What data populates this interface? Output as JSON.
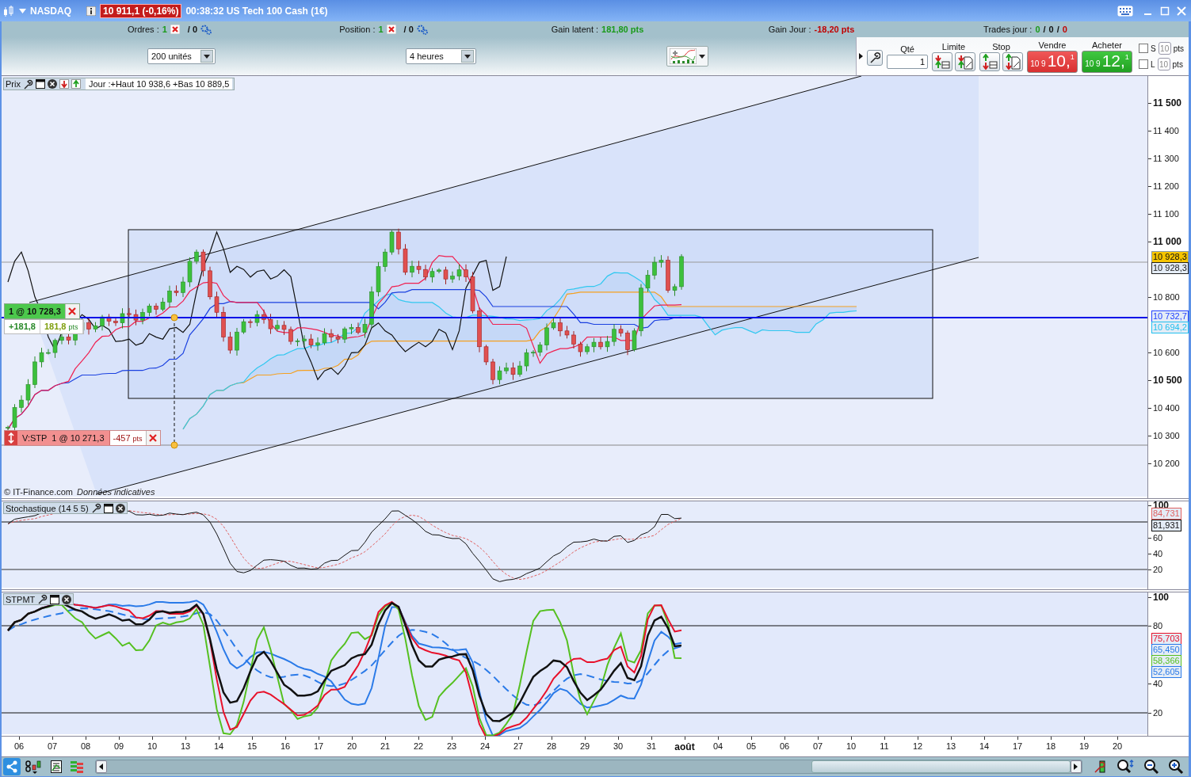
{
  "title_bar": {
    "instrument": "NASDAQ",
    "quote": "10 911,1 (-0,16%)",
    "description": "00:38:32 US Tech 100 Cash (1€)"
  },
  "info_bar": [
    {
      "kind": "count",
      "label": "Ordres :",
      "value": "1",
      "total": "/ 0"
    },
    {
      "kind": "count",
      "label": "Position :",
      "value": "1",
      "total": "/ 0"
    },
    {
      "kind": "gain",
      "label": "Gain latent :",
      "value": "181,80 pts",
      "color": "#1a9a1a"
    },
    {
      "kind": "gain",
      "label": "Gain Jour :",
      "value": "-18,20 pts",
      "color": "#c00000"
    },
    {
      "kind": "trades",
      "label": "Trades jour :",
      "values": [
        {
          "text": "0",
          "color": "#1a9a1a"
        },
        {
          "text": "0",
          "color": "#111111"
        },
        {
          "text": "0",
          "color": "#c00000"
        }
      ],
      "separators": [
        "/",
        "/"
      ]
    }
  ],
  "toolbar": {
    "units": "200 unités",
    "period": "4 heures"
  },
  "order_panel": {
    "qty_label": "Qté",
    "qty": "1",
    "limit_label": "Limite",
    "stop_label": "Stop",
    "sell": {
      "label": "Vendre",
      "prefix": "10 9",
      "big": "10,",
      "sup": "1"
    },
    "buy": {
      "label": "Acheter",
      "prefix": "10 9",
      "big": "12,",
      "sup": "1"
    },
    "stops": [
      {
        "label": "S",
        "value": "10",
        "unit": "pts",
        "checked": false
      },
      {
        "label": "L",
        "value": "10",
        "unit": "pts",
        "checked": false
      }
    ]
  },
  "price_pane": {
    "legend": "Prix",
    "day_info": "Jour :+Haut 10 938,6 +Bas 10 889,5",
    "y_ticks": [
      {
        "label": "11 500",
        "bold": true
      },
      {
        "label": "11 400",
        "bold": false
      },
      {
        "label": "11 300",
        "bold": false
      },
      {
        "label": "11 200",
        "bold": false
      },
      {
        "label": "11 100",
        "bold": false
      },
      {
        "label": "11 000",
        "bold": true
      },
      {
        "label": "10 800",
        "bold": false
      },
      {
        "label": "10 600",
        "bold": false
      },
      {
        "label": "10 500",
        "bold": true
      },
      {
        "label": "10 400",
        "bold": false
      },
      {
        "label": "10 300",
        "bold": false
      },
      {
        "label": "10 200",
        "bold": false
      }
    ],
    "tags": [
      {
        "text": "10 928,3",
        "kind": "filled",
        "color": "#f5c400"
      },
      {
        "text": "10 928,3",
        "kind": "outlined",
        "color": "#222222"
      },
      {
        "text": "10 732,7",
        "kind": "outlined",
        "color": "#2040ff"
      },
      {
        "text": "10 694,2",
        "kind": "outlined",
        "color": "#22c0ee"
      }
    ],
    "position_tag": {
      "label": "1 @ 10 728,3",
      "pnl": "+181,8",
      "points": "181,8",
      "unit": "pts"
    },
    "stop_tag": {
      "label": "V:STP  1 @ 10 271,3",
      "points": "-457",
      "unit": "pts"
    },
    "copyright": "© IT-Finance.com",
    "disclaimer": "Données indicatives"
  },
  "stochastic_pane": {
    "legend": "Stochastique (14 5 5)",
    "y_ticks": [
      {
        "label": "100",
        "bold": true
      },
      {
        "label": "60",
        "bold": false
      },
      {
        "label": "40",
        "bold": false
      },
      {
        "label": "20",
        "bold": false
      }
    ],
    "tags": [
      {
        "text": "84,731",
        "color": "#e06060"
      },
      {
        "text": "81,931",
        "color": "#111111"
      }
    ]
  },
  "stpmt_pane": {
    "legend": "STPMT",
    "y_ticks": [
      {
        "label": "100",
        "bold": true
      },
      {
        "label": "80",
        "bold": false
      },
      {
        "label": "40",
        "bold": false
      },
      {
        "label": "20",
        "bold": false
      }
    ],
    "tags": [
      {
        "text": "75,703",
        "color": "#e8102a"
      },
      {
        "text": "65,450",
        "color": "#2a7ae8"
      },
      {
        "text": "58,366",
        "color": "#55c020"
      },
      {
        "text": "52,605",
        "color": "#2a7ae8"
      }
    ]
  },
  "x_axis": [
    {
      "label": "06",
      "bold": false
    },
    {
      "label": "07",
      "bold": false
    },
    {
      "label": "08",
      "bold": false
    },
    {
      "label": "09",
      "bold": false
    },
    {
      "label": "10",
      "bold": false
    },
    {
      "label": "13",
      "bold": false
    },
    {
      "label": "14",
      "bold": false
    },
    {
      "label": "15",
      "bold": false
    },
    {
      "label": "16",
      "bold": false
    },
    {
      "label": "17",
      "bold": false
    },
    {
      "label": "20",
      "bold": false
    },
    {
      "label": "21",
      "bold": false
    },
    {
      "label": "22",
      "bold": false
    },
    {
      "label": "23",
      "bold": false
    },
    {
      "label": "24",
      "bold": false
    },
    {
      "label": "27",
      "bold": false
    },
    {
      "label": "28",
      "bold": false
    },
    {
      "label": "29",
      "bold": false
    },
    {
      "label": "30",
      "bold": false
    },
    {
      "label": "31",
      "bold": false
    },
    {
      "label": "août",
      "bold": true
    },
    {
      "label": "04",
      "bold": false
    },
    {
      "label": "05",
      "bold": false
    },
    {
      "label": "06",
      "bold": false
    },
    {
      "label": "07",
      "bold": false
    },
    {
      "label": "10",
      "bold": false
    },
    {
      "label": "11",
      "bold": false
    },
    {
      "label": "12",
      "bold": false
    },
    {
      "label": "13",
      "bold": false
    },
    {
      "label": "14",
      "bold": false
    },
    {
      "label": "17",
      "bold": false
    },
    {
      "label": "18",
      "bold": false
    },
    {
      "label": "19",
      "bold": false
    },
    {
      "label": "20",
      "bold": false
    }
  ]
}
